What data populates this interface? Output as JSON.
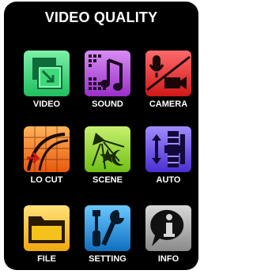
{
  "title": "VIDEO QUALITY",
  "menu": {
    "items": [
      {
        "label": "VIDEO",
        "icon": "video-icon",
        "color": "#3fd97a"
      },
      {
        "label": "SOUND",
        "icon": "sound-icon",
        "color": "#b04ad8"
      },
      {
        "label": "CAMERA",
        "icon": "camera-icon",
        "color": "#e82a2a"
      },
      {
        "label": "LO CUT",
        "icon": "lo-cut-icon",
        "color": "#ef7a1a"
      },
      {
        "label": "SCENE",
        "icon": "scene-icon",
        "color": "#8fd42a"
      },
      {
        "label": "AUTO",
        "icon": "auto-icon",
        "color": "#6a4fe0"
      },
      {
        "label": "FILE",
        "icon": "folder-icon",
        "color": "#f4c21a"
      },
      {
        "label": "SETTING",
        "icon": "tools-icon",
        "color": "#1e8fd8"
      },
      {
        "label": "INFO",
        "icon": "info-icon",
        "color": "#9a9a9a"
      }
    ]
  }
}
